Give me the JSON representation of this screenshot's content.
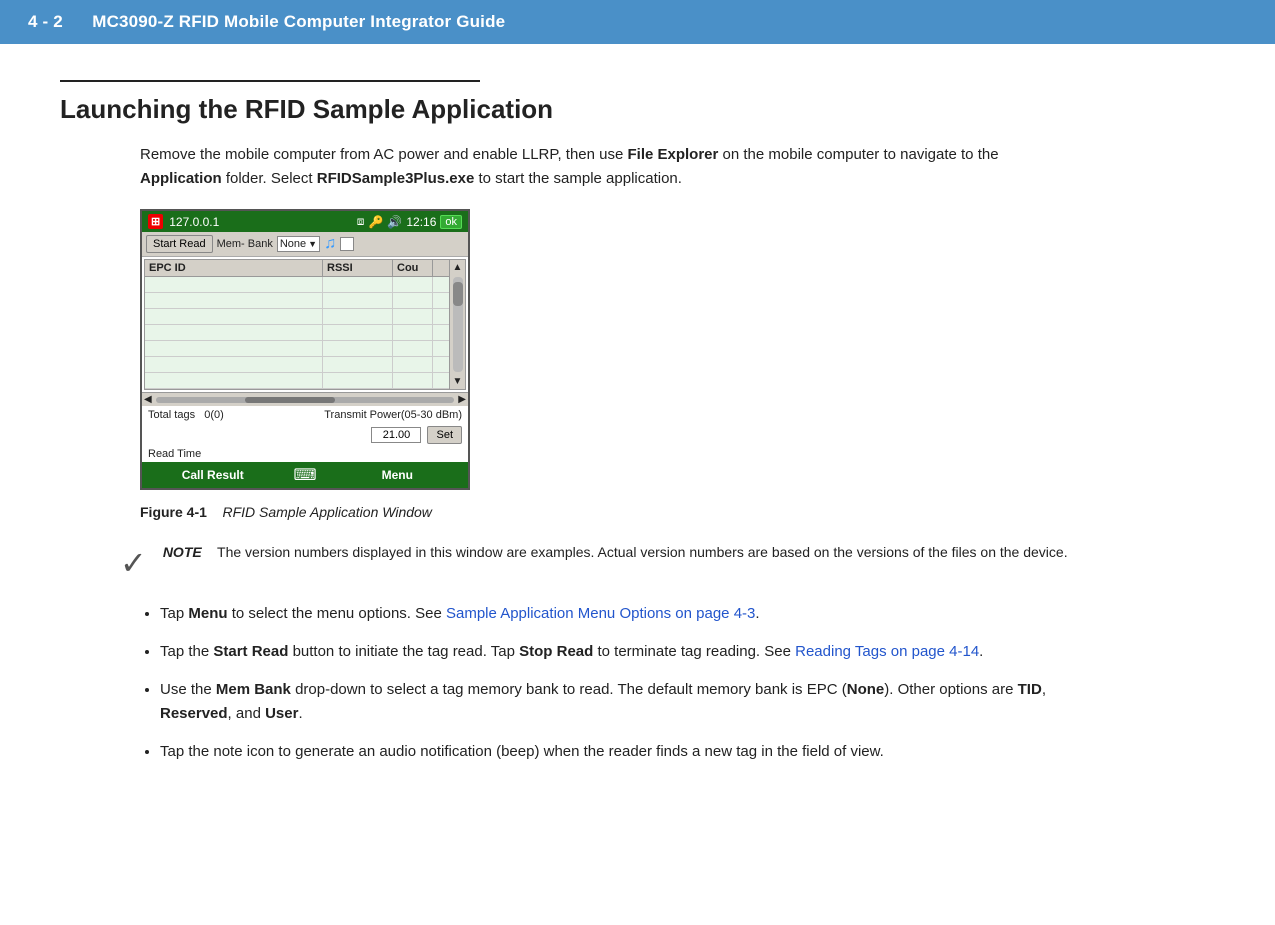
{
  "header": {
    "chapter": "4 - 2",
    "title": "MC3090-Z RFID Mobile Computer Integrator Guide"
  },
  "section": {
    "title": "Launching the RFID Sample Application",
    "intro_p1": "Remove the mobile computer from AC power and enable LLRP, then use ",
    "intro_bold1": "File Explorer",
    "intro_p2": " on the mobile computer to navigate to the ",
    "intro_bold2": "Application",
    "intro_p3": " folder. Select ",
    "intro_bold3": "RFIDSample3Plus.exe",
    "intro_p4": " to start the sample application."
  },
  "device": {
    "titlebar_ip": "127.0.0.1",
    "titlebar_time": "12:16",
    "ok_label": "ok",
    "start_read_btn": "Start Read",
    "mem_bank_label": "Mem- Bank",
    "mem_bank_value": "None",
    "table_cols": [
      "EPC ID",
      "RSSI",
      "Cou"
    ],
    "table_rows": [
      [
        "",
        "",
        ""
      ],
      [
        "",
        "",
        ""
      ],
      [
        "",
        "",
        ""
      ],
      [
        "",
        "",
        ""
      ],
      [
        "",
        "",
        ""
      ]
    ],
    "total_tags_label": "Total tags",
    "total_tags_value": "0(0)",
    "transmit_power_label": "Transmit Power(05-30 dBm)",
    "power_value": "21.00",
    "set_btn": "Set",
    "read_time_label": "Read Time",
    "call_result_btn": "Call Result",
    "menu_btn": "Menu"
  },
  "figure": {
    "label": "Figure 4-1",
    "caption": "RFID Sample Application Window"
  },
  "note": {
    "label": "NOTE",
    "text": "The version numbers displayed in this window are examples. Actual version numbers are based on the versions of the files on the device."
  },
  "bullets": [
    {
      "text_before": "Tap ",
      "bold": "Menu",
      "text_after": " to select the menu options. See ",
      "link_text": "Sample Application Menu Options on page 4-3",
      "text_end": "."
    },
    {
      "text_before": "Tap the ",
      "bold": "Start Read",
      "text_after": " button to initiate the tag read. Tap ",
      "bold2": "Stop Read",
      "text_after2": " to terminate tag reading. See ",
      "link_text": "Reading Tags on page 4-14",
      "text_end": "."
    },
    {
      "text_before": "Use the ",
      "bold": "Mem Bank",
      "text_after": " drop-down to select a tag memory bank to read. The default memory bank is EPC (",
      "bold2": "None",
      "text_after2": "). Other options are ",
      "bold3": "TID",
      "text_after3": ", ",
      "bold4": "Reserved",
      "text_after4": ", and ",
      "bold5": "User",
      "text_end": "."
    },
    {
      "text_before": "Tap the note icon to generate an audio notification (beep) when the reader finds a new tag in the field of view.",
      "bold": "",
      "text_after": ""
    }
  ]
}
